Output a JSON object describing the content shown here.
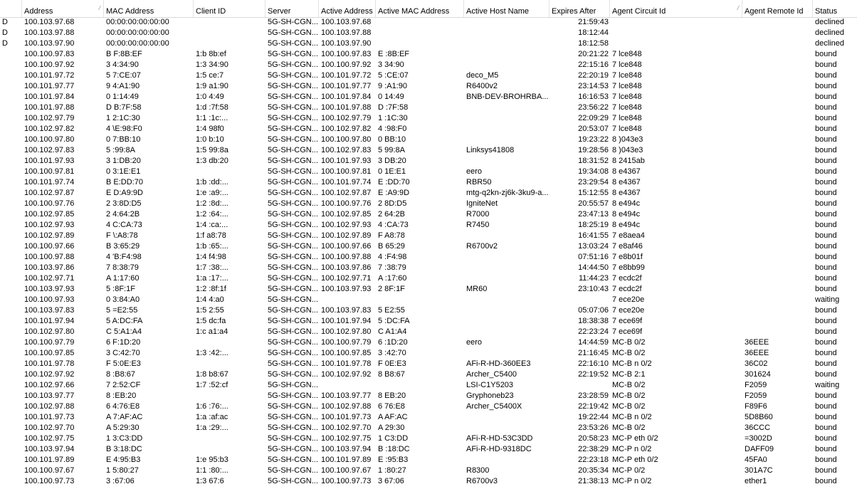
{
  "columns": [
    {
      "key": "flag",
      "label": ""
    },
    {
      "key": "address",
      "label": "Address",
      "sorted": true
    },
    {
      "key": "mac",
      "label": "MAC Address"
    },
    {
      "key": "client_id",
      "label": "Client ID"
    },
    {
      "key": "server",
      "label": "Server"
    },
    {
      "key": "active_address",
      "label": "Active Address"
    },
    {
      "key": "active_mac",
      "label": "Active MAC Address"
    },
    {
      "key": "active_host",
      "label": "Active Host Name"
    },
    {
      "key": "expires",
      "label": "Expires After"
    },
    {
      "key": "circuit",
      "label": "Agent Circuit Id",
      "sorted": true
    },
    {
      "key": "remote",
      "label": "Agent Remote Id"
    },
    {
      "key": "status",
      "label": "Status"
    }
  ],
  "sort_indicator": "⁄",
  "rows": [
    {
      "flag": "D",
      "address": "100.103.97.68",
      "mac": "00:00:00:00:00:00",
      "client_id": "",
      "server": "5G-SH-CGN...",
      "active_address": "100.103.97.68",
      "active_mac": "",
      "active_host": "",
      "expires": "21:59:43",
      "circuit": "",
      "remote": "",
      "status": "declined"
    },
    {
      "flag": "D",
      "address": "100.103.97.88",
      "mac": "00:00:00:00:00:00",
      "client_id": "",
      "server": "5G-SH-CGN...",
      "active_address": "100.103.97.88",
      "active_mac": "",
      "active_host": "",
      "expires": "18:12:44",
      "circuit": "",
      "remote": "",
      "status": "declined"
    },
    {
      "flag": "D",
      "address": "100.103.97.90",
      "mac": "00:00:00:00:00:00",
      "client_id": "",
      "server": "5G-SH-CGN...",
      "active_address": "100.103.97.90",
      "active_mac": "",
      "active_host": "",
      "expires": "18:12:58",
      "circuit": "",
      "remote": "",
      "status": "declined"
    },
    {
      "flag": "",
      "address": "100.100.97.83",
      "mac": "B F:8B:EF",
      "client_id": "1:b 8b:ef",
      "server": "5G-SH-CGN...",
      "active_address": "100.100.97.83",
      "active_mac": "E :8B:EF",
      "active_host": "",
      "expires": "20:21:22",
      "circuit": "7 lce848",
      "remote": "",
      "status": "bound"
    },
    {
      "flag": "",
      "address": "100.100.97.92",
      "mac": "3 4:34:90",
      "client_id": "1:3 34:90",
      "server": "5G-SH-CGN...",
      "active_address": "100.100.97.92",
      "active_mac": "3 34:90",
      "active_host": "",
      "expires": "22:15:16",
      "circuit": "7 lce848",
      "remote": "",
      "status": "bound"
    },
    {
      "flag": "",
      "address": "100.101.97.72",
      "mac": "5 7:CE:07",
      "client_id": "1:5 ce:7",
      "server": "5G-SH-CGN...",
      "active_address": "100.101.97.72",
      "active_mac": "5 :CE:07",
      "active_host": "deco_M5",
      "expires": "22:20:19",
      "circuit": "7 lce848",
      "remote": "",
      "status": "bound"
    },
    {
      "flag": "",
      "address": "100.101.97.77",
      "mac": "9 4:A1:90",
      "client_id": "1:9 a1:90",
      "server": "5G-SH-CGN...",
      "active_address": "100.101.97.77",
      "active_mac": "9 :A1:90",
      "active_host": "R6400v2",
      "expires": "23:14:53",
      "circuit": "7 lce848",
      "remote": "",
      "status": "bound"
    },
    {
      "flag": "",
      "address": "100.101.97.84",
      "mac": "0 1:14:49",
      "client_id": "1:0 4:49",
      "server": "5G-SH-CGN...",
      "active_address": "100.101.97.84",
      "active_mac": "0 14:49",
      "active_host": "BNB-DEV-BROHRBA...",
      "expires": "16:16:53",
      "circuit": "7 lce848",
      "remote": "",
      "status": "bound"
    },
    {
      "flag": "",
      "address": "100.101.97.88",
      "mac": "D B:7F:58",
      "client_id": "1:d :7f:58",
      "server": "5G-SH-CGN...",
      "active_address": "100.101.97.88",
      "active_mac": "D :7F:58",
      "active_host": "",
      "expires": "23:56:22",
      "circuit": "7 lce848",
      "remote": "",
      "status": "bound"
    },
    {
      "flag": "",
      "address": "100.102.97.79",
      "mac": "1 2:1C:30",
      "client_id": "1:1 :1c:...",
      "server": "5G-SH-CGN...",
      "active_address": "100.102.97.79",
      "active_mac": "1 :1C:30",
      "active_host": "",
      "expires": "22:09:29",
      "circuit": "7 lce848",
      "remote": "",
      "status": "bound"
    },
    {
      "flag": "",
      "address": "100.102.97.82",
      "mac": "4 \\E:98:F0",
      "client_id": "1:4 98f0",
      "server": "5G-SH-CGN...",
      "active_address": "100.102.97.82",
      "active_mac": "4 :98:F0",
      "active_host": "",
      "expires": "20:53:07",
      "circuit": "7 lce848",
      "remote": "",
      "status": "bound"
    },
    {
      "flag": "",
      "address": "100.100.97.80",
      "mac": "0 7:BB:10",
      "client_id": "1:0 b:10",
      "server": "5G-SH-CGN...",
      "active_address": "100.100.97.80",
      "active_mac": "0 BB:10",
      "active_host": "",
      "expires": "19:23:22",
      "circuit": "8 )043e3",
      "remote": "",
      "status": "bound"
    },
    {
      "flag": "",
      "address": "100.102.97.83",
      "mac": "5 :99:8A",
      "client_id": "1:5 99:8a",
      "server": "5G-SH-CGN...",
      "active_address": "100.102.97.83",
      "active_mac": "5 99:8A",
      "active_host": "Linksys41808",
      "expires": "19:28:56",
      "circuit": "8 )043e3",
      "remote": "",
      "status": "bound"
    },
    {
      "flag": "",
      "address": "100.101.97.93",
      "mac": "3 1:DB:20",
      "client_id": "1:3 db:20",
      "server": "5G-SH-CGN...",
      "active_address": "100.101.97.93",
      "active_mac": "3 DB:20",
      "active_host": "",
      "expires": "18:31:52",
      "circuit": "8 2415ab",
      "remote": "",
      "status": "bound"
    },
    {
      "flag": "",
      "address": "100.100.97.81",
      "mac": "0 3:1E:E1",
      "client_id": "",
      "server": "5G-SH-CGN...",
      "active_address": "100.100.97.81",
      "active_mac": "0 1E:E1",
      "active_host": "eero",
      "expires": "19:34:08",
      "circuit": "8 e4367",
      "remote": "",
      "status": "bound"
    },
    {
      "flag": "",
      "address": "100.101.97.74",
      "mac": "B E:DD:70",
      "client_id": "1:b :dd:...",
      "server": "5G-SH-CGN...",
      "active_address": "100.101.97.74",
      "active_mac": "E :DD:70",
      "active_host": "RBR50",
      "expires": "23:29:54",
      "circuit": "8 e4367",
      "remote": "",
      "status": "bound"
    },
    {
      "flag": "",
      "address": "100.102.97.87",
      "mac": "E D:A9:9D",
      "client_id": "1:e :a9:...",
      "server": "5G-SH-CGN...",
      "active_address": "100.102.97.87",
      "active_mac": "E :A9:9D",
      "active_host": "mtg-q2kn-zj6k-3ku9-a...",
      "expires": "15:12:55",
      "circuit": "8 e4367",
      "remote": "",
      "status": "bound"
    },
    {
      "flag": "",
      "address": "100.100.97.76",
      "mac": "2 3:8D:D5",
      "client_id": "1:2 :8d:...",
      "server": "5G-SH-CGN...",
      "active_address": "100.100.97.76",
      "active_mac": "2 8D:D5",
      "active_host": "IgniteNet",
      "expires": "20:55:57",
      "circuit": "8 e494c",
      "remote": "",
      "status": "bound"
    },
    {
      "flag": "",
      "address": "100.102.97.85",
      "mac": "2 4:64:2B",
      "client_id": "1:2 :64:...",
      "server": "5G-SH-CGN...",
      "active_address": "100.102.97.85",
      "active_mac": "2 64:2B",
      "active_host": "R7000",
      "expires": "23:47:13",
      "circuit": "8 e494c",
      "remote": "",
      "status": "bound"
    },
    {
      "flag": "",
      "address": "100.102.97.93",
      "mac": "4 C:CA:73",
      "client_id": "1:4 :ca:...",
      "server": "5G-SH-CGN...",
      "active_address": "100.102.97.93",
      "active_mac": "4 :CA:73",
      "active_host": "R7450",
      "expires": "18:25:19",
      "circuit": "8 e494c",
      "remote": "",
      "status": "bound"
    },
    {
      "flag": "",
      "address": "100.102.97.89",
      "mac": "F \\:A8:78",
      "client_id": "1:f a8:78",
      "server": "5G-SH-CGN...",
      "active_address": "100.102.97.89",
      "active_mac": "F A8:78",
      "active_host": "",
      "expires": "16:41:55",
      "circuit": "7 e8aea4",
      "remote": "",
      "status": "bound"
    },
    {
      "flag": "",
      "address": "100.100.97.66",
      "mac": "B 3:65:29",
      "client_id": "1:b :65:...",
      "server": "5G-SH-CGN...",
      "active_address": "100.100.97.66",
      "active_mac": "B 65:29",
      "active_host": "R6700v2",
      "expires": "13:03:24",
      "circuit": "7 e8af46",
      "remote": "",
      "status": "bound"
    },
    {
      "flag": "",
      "address": "100.100.97.88",
      "mac": "4 'B:F4:98",
      "client_id": "1:4 f4:98",
      "server": "5G-SH-CGN...",
      "active_address": "100.100.97.88",
      "active_mac": "4 :F4:98",
      "active_host": "",
      "expires": "07:51:16",
      "circuit": "7 e8b01f",
      "remote": "",
      "status": "bound"
    },
    {
      "flag": "",
      "address": "100.103.97.86",
      "mac": "7 8:38:79",
      "client_id": "1:7 :38:...",
      "server": "5G-SH-CGN...",
      "active_address": "100.103.97.86",
      "active_mac": "7 :38:79",
      "active_host": "",
      "expires": "14:44:50",
      "circuit": "7 e8bb99",
      "remote": "",
      "status": "bound"
    },
    {
      "flag": "",
      "address": "100.102.97.71",
      "mac": "A 1:17:60",
      "client_id": "1:a :17:...",
      "server": "5G-SH-CGN...",
      "active_address": "100.102.97.71",
      "active_mac": "A :17:60",
      "active_host": "",
      "expires": "11:44:23",
      "circuit": "7 ecdc2f",
      "remote": "",
      "status": "bound"
    },
    {
      "flag": "",
      "address": "100.103.97.93",
      "mac": "5 :8F:1F",
      "client_id": "1:2 :8f:1f",
      "server": "5G-SH-CGN...",
      "active_address": "100.103.97.93",
      "active_mac": "2 8F:1F",
      "active_host": "MR60",
      "expires": "23:10:43",
      "circuit": "7 ecdc2f",
      "remote": "",
      "status": "bound"
    },
    {
      "flag": "",
      "address": "100.100.97.93",
      "mac": "0 3:84:A0",
      "client_id": "1:4 4:a0",
      "server": "5G-SH-CGN...",
      "active_address": "",
      "active_mac": "",
      "active_host": "",
      "expires": "",
      "circuit": "7 ece20e",
      "remote": "",
      "status": "waiting"
    },
    {
      "flag": "",
      "address": "100.103.97.83",
      "mac": "5 =E2:55",
      "client_id": "1:5 2:55",
      "server": "5G-SH-CGN...",
      "active_address": "100.103.97.83",
      "active_mac": "5 E2:55",
      "active_host": "",
      "expires": "05:07:06",
      "circuit": "7 ece20e",
      "remote": "",
      "status": "bound"
    },
    {
      "flag": "",
      "address": "100.101.97.94",
      "mac": "5 A:DC:FA",
      "client_id": "1:5 dc:fa",
      "server": "5G-SH-CGN...",
      "active_address": "100.101.97.94",
      "active_mac": "5 :DC:FA",
      "active_host": "",
      "expires": "18:38:38",
      "circuit": "7 ece69f",
      "remote": "",
      "status": "bound"
    },
    {
      "flag": "",
      "address": "100.102.97.80",
      "mac": "C 5:A1:A4",
      "client_id": "1:c a1:a4",
      "server": "5G-SH-CGN...",
      "active_address": "100.102.97.80",
      "active_mac": "C A1:A4",
      "active_host": "",
      "expires": "22:23:24",
      "circuit": "7 ece69f",
      "remote": "",
      "status": "bound"
    },
    {
      "flag": "",
      "address": "100.100.97.79",
      "mac": "6 F:1D:20",
      "client_id": "",
      "server": "5G-SH-CGN...",
      "active_address": "100.100.97.79",
      "active_mac": "6 :1D:20",
      "active_host": "eero",
      "expires": "14:44:59",
      "circuit": "MC-B 0/2",
      "remote": "36EEE",
      "status": "bound"
    },
    {
      "flag": "",
      "address": "100.100.97.85",
      "mac": "3 C:42:70",
      "client_id": "1:3 :42:...",
      "server": "5G-SH-CGN...",
      "active_address": "100.100.97.85",
      "active_mac": "3 :42:70",
      "active_host": "",
      "expires": "21:16:45",
      "circuit": "MC-B 0/2",
      "remote": "36EEE",
      "status": "bound"
    },
    {
      "flag": "",
      "address": "100.101.97.78",
      "mac": "F 5:0E:E3",
      "client_id": "",
      "server": "5G-SH-CGN...",
      "active_address": "100.101.97.78",
      "active_mac": "F 0E:E3",
      "active_host": "AFi-R-HD-360EE3",
      "expires": "22:16:10",
      "circuit": "MC-B n 0/2",
      "remote": "36C02",
      "status": "bound"
    },
    {
      "flag": "",
      "address": "100.102.97.92",
      "mac": "8 :B8:67",
      "client_id": "1:8 b8:67",
      "server": "5G-SH-CGN...",
      "active_address": "100.102.97.92",
      "active_mac": "8 B8:67",
      "active_host": "Archer_C5400",
      "expires": "22:19:52",
      "circuit": "MC-B 2:1",
      "remote": "301624",
      "status": "bound"
    },
    {
      "flag": "",
      "address": "100.102.97.66",
      "mac": "7 2:52:CF",
      "client_id": "1:7 :52:cf",
      "server": "5G-SH-CGN...",
      "active_address": "",
      "active_mac": "",
      "active_host": "LSI-C1Y5203",
      "expires": "",
      "circuit": "MC-B 0/2",
      "remote": "F2059",
      "status": "waiting"
    },
    {
      "flag": "",
      "address": "100.103.97.77",
      "mac": "8 :EB:20",
      "client_id": "",
      "server": "5G-SH-CGN...",
      "active_address": "100.103.97.77",
      "active_mac": "8 EB:20",
      "active_host": "Gryphoneb23",
      "expires": "23:28:59",
      "circuit": "MC-B 0/2",
      "remote": "F2059",
      "status": "bound"
    },
    {
      "flag": "",
      "address": "100.102.97.88",
      "mac": "6 4:76:E8",
      "client_id": "1:6 :76:...",
      "server": "5G-SH-CGN...",
      "active_address": "100.102.97.88",
      "active_mac": "6 76:E8",
      "active_host": "Archer_C5400X",
      "expires": "22:19:42",
      "circuit": "MC-B 0/2",
      "remote": "F89F6",
      "status": "bound"
    },
    {
      "flag": "",
      "address": "100.101.97.73",
      "mac": "A 7:AF:AC",
      "client_id": "1:a :af:ac",
      "server": "5G-SH-CGN...",
      "active_address": "100.101.97.73",
      "active_mac": "A AF:AC",
      "active_host": "",
      "expires": "19:22:44",
      "circuit": "MC-B n 0/2",
      "remote": "5D8B60",
      "status": "bound"
    },
    {
      "flag": "",
      "address": "100.102.97.70",
      "mac": "A 5:29:30",
      "client_id": "1:a :29:...",
      "server": "5G-SH-CGN...",
      "active_address": "100.102.97.70",
      "active_mac": "A 29:30",
      "active_host": "",
      "expires": "23:53:26",
      "circuit": "MC-B 0/2",
      "remote": "36CCC",
      "status": "bound"
    },
    {
      "flag": "",
      "address": "100.102.97.75",
      "mac": "1 3:C3:DD",
      "client_id": "",
      "server": "5G-SH-CGN...",
      "active_address": "100.102.97.75",
      "active_mac": "1 C3:DD",
      "active_host": "AFi-R-HD-53C3DD",
      "expires": "20:58:23",
      "circuit": "MC-P eth 0/2",
      "remote": "=3002D",
      "status": "bound"
    },
    {
      "flag": "",
      "address": "100.103.97.94",
      "mac": "B 3:18:DC",
      "client_id": "",
      "server": "5G-SH-CGN...",
      "active_address": "100.103.97.94",
      "active_mac": "B :18:DC",
      "active_host": "AFi-R-HD-9318DC",
      "expires": "22:38:29",
      "circuit": "MC-P n 0/2",
      "remote": "DAFF09",
      "status": "bound"
    },
    {
      "flag": "",
      "address": "100.101.97.89",
      "mac": "E 4:95:B3",
      "client_id": "1:e 95:b3",
      "server": "5G-SH-CGN...",
      "active_address": "100.101.97.89",
      "active_mac": "E :95:B3",
      "active_host": "",
      "expires": "22:23:18",
      "circuit": "MC-P eth 0/2",
      "remote": "45FA0",
      "status": "bound"
    },
    {
      "flag": "",
      "address": "100.100.97.67",
      "mac": "1 5:80:27",
      "client_id": "1:1 :80:...",
      "server": "5G-SH-CGN...",
      "active_address": "100.100.97.67",
      "active_mac": "1 :80:27",
      "active_host": "R8300",
      "expires": "20:35:34",
      "circuit": "MC-P 0/2",
      "remote": "301A7C",
      "status": "bound"
    },
    {
      "flag": "",
      "address": "100.100.97.73",
      "mac": "3 :67:06",
      "client_id": "1:3 67:6",
      "server": "5G-SH-CGN...",
      "active_address": "100.100.97.73",
      "active_mac": "3 67:06",
      "active_host": "R6700v3",
      "expires": "21:38:13",
      "circuit": "MC-P n 0/2",
      "remote": "ether1",
      "status": "bound"
    }
  ]
}
